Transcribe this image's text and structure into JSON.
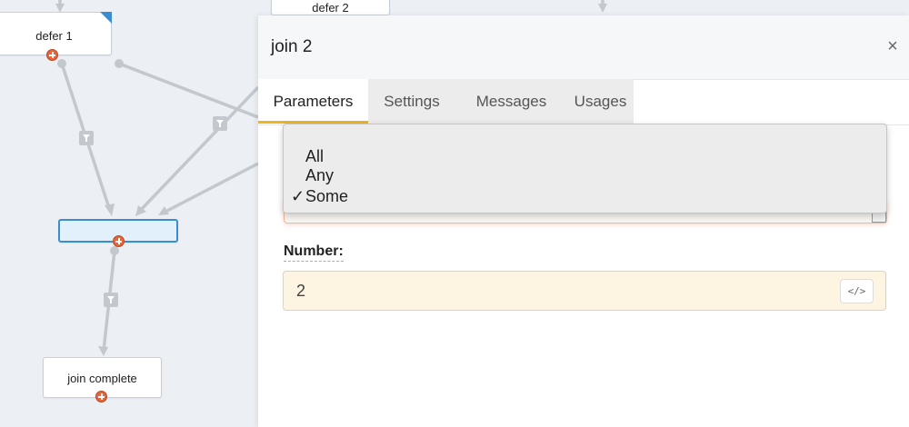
{
  "canvas": {
    "nodes": [
      {
        "id": "defer1",
        "label": "defer 1"
      },
      {
        "id": "defer2",
        "label": "defer 2"
      },
      {
        "id": "join2",
        "label": ""
      },
      {
        "id": "joincomplete",
        "label": "join complete"
      }
    ]
  },
  "panel": {
    "title": "join 2",
    "close_icon": "×",
    "tabs": [
      {
        "label": "Parameters",
        "active": true
      },
      {
        "label": "Settings",
        "active": false
      },
      {
        "label": "Messages",
        "active": false
      },
      {
        "label": "Usages",
        "active": false
      }
    ],
    "mode_dropdown": {
      "options": [
        {
          "label": "All",
          "checked": false
        },
        {
          "label": "Any",
          "checked": false
        },
        {
          "label": "Some",
          "checked": true
        }
      ],
      "check_glyph": "✓"
    },
    "number": {
      "label": "Number:",
      "value": "2",
      "code_button": "</>"
    }
  },
  "colors": {
    "accent_tab": "#f0b41c",
    "selected_node": "#3c8dd0",
    "port": "#e8643a",
    "number_field_bg": "#fdf5e1"
  }
}
